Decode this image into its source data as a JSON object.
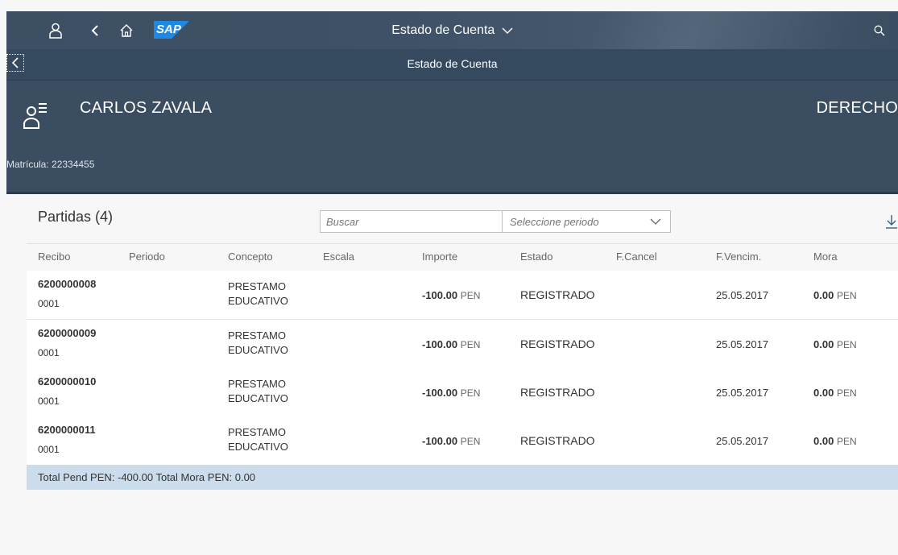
{
  "shell": {
    "title": "Estado de Cuenta",
    "brand": "SAP"
  },
  "subheader": {
    "title": "Estado de Cuenta"
  },
  "object_header": {
    "name": "CARLOS ZAVALA",
    "right_title": "DERECHO",
    "matricula": "Matrícula: 22334455"
  },
  "table": {
    "title": "Partidas (4)",
    "search_placeholder": "Buscar",
    "period_placeholder": "Seleccione periodo",
    "columns": [
      "Recibo",
      "Periodo",
      "Concepto",
      "Escala",
      "Importe",
      "Estado",
      "F.Cancel",
      "F.Vencim.",
      "Mora"
    ],
    "rows": [
      {
        "recibo": "6200000008",
        "sub": "0001",
        "concepto1": "PRESTAMO",
        "concepto2": "EDUCATIVO",
        "importe": "-100.00",
        "importe_unit": "PEN",
        "estado": "REGISTRADO",
        "vencim": "25.05.2017",
        "mora": "0.00",
        "mora_unit": "PEN"
      },
      {
        "recibo": "6200000009",
        "sub": "0001",
        "concepto1": "PRESTAMO",
        "concepto2": "EDUCATIVO",
        "importe": "-100.00",
        "importe_unit": "PEN",
        "estado": "REGISTRADO",
        "vencim": "25.05.2017",
        "mora": "0.00",
        "mora_unit": "PEN"
      },
      {
        "recibo": "6200000010",
        "sub": "0001",
        "concepto1": "PRESTAMO",
        "concepto2": "EDUCATIVO",
        "importe": "-100.00",
        "importe_unit": "PEN",
        "estado": "REGISTRADO",
        "vencim": "25.05.2017",
        "mora": "0.00",
        "mora_unit": "PEN"
      },
      {
        "recibo": "6200000011",
        "sub": "0001",
        "concepto1": "PRESTAMO",
        "concepto2": "EDUCATIVO",
        "importe": "-100.00",
        "importe_unit": "PEN",
        "estado": "REGISTRADO",
        "vencim": "25.05.2017",
        "mora": "0.00",
        "mora_unit": "PEN"
      }
    ],
    "footer": "Total Pend PEN: -400.00 Total Mora PEN: 0.00"
  },
  "icons": {
    "user": "user-icon",
    "back": "back-icon",
    "home": "home-icon",
    "search": "search-icon",
    "chevron": "chevron-down-icon",
    "download": "download-icon",
    "avatar": "person-list-icon"
  },
  "colors": {
    "shell": "#3f5166",
    "header": "#3a4d61",
    "footer": "#cbdcec"
  }
}
